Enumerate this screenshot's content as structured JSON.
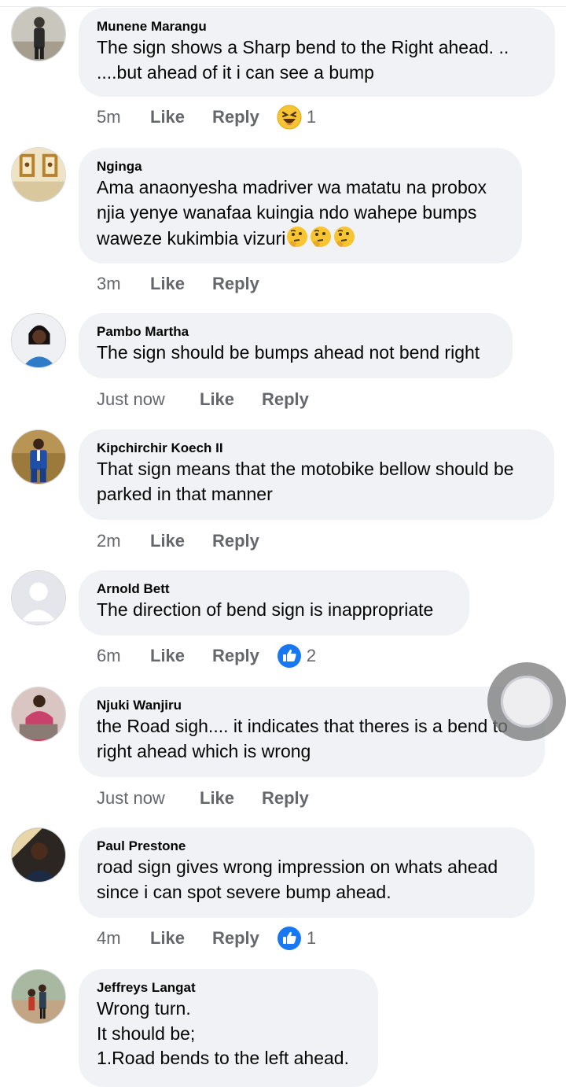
{
  "comments": [
    {
      "author": "Munene Marangu",
      "text": "The sign shows a Sharp bend to the Right ahead.      ..\n....but ahead of it i can see a bump",
      "time": "5m",
      "like": "Like",
      "reply": "Reply",
      "reaction": {
        "icon": "laughing-emoji-icon",
        "count": "1"
      }
    },
    {
      "author": "Nginga",
      "text": "Ama anaonyesha madriver wa matatu na probox\nnjia yenye wanafaa kuingia ndo wahepe bumps\nwaweze kukimbia vizuri",
      "time": "3m",
      "like": "Like",
      "reply": "Reply",
      "trailing_emojis": [
        "thinking-face-icon",
        "thinking-face-icon",
        "thinking-face-icon"
      ]
    },
    {
      "author": "Pambo Martha",
      "text": "The sign should be bumps ahead not bend right",
      "time": "Just now",
      "like": "Like",
      "reply": "Reply"
    },
    {
      "author": "Kipchirchir Koech II",
      "text": "That sign means that the motobike bellow should be\nparked in that manner",
      "time": "2m",
      "like": "Like",
      "reply": "Reply"
    },
    {
      "author": "Arnold Bett",
      "text": "The direction of bend sign is inappropriate",
      "time": "6m",
      "like": "Like",
      "reply": "Reply",
      "reaction": {
        "icon": "thumbs-up-icon",
        "count": "2"
      }
    },
    {
      "author": "Njuki Wanjiru",
      "text": "the Road sigh.... it indicates that theres is a bend to\nright ahead which is wrong",
      "time": "Just now",
      "like": "Like",
      "reply": "Reply"
    },
    {
      "author": "Paul Prestone",
      "text": "road sign gives wrong impression on whats ahead\nsince i can spot severe bump ahead.",
      "time": "4m",
      "like": "Like",
      "reply": "Reply",
      "reaction": {
        "icon": "thumbs-up-icon",
        "count": "1"
      }
    },
    {
      "author": "Jeffreys Langat",
      "text": "Wrong turn.\nIt should be;\n1.Road bends to the left ahead.",
      "time": "",
      "like": "",
      "reply": ""
    }
  ],
  "colors": {
    "bubble": "#f0f2f5",
    "meta_text": "#65676b",
    "like_blue": "#1877f2"
  }
}
